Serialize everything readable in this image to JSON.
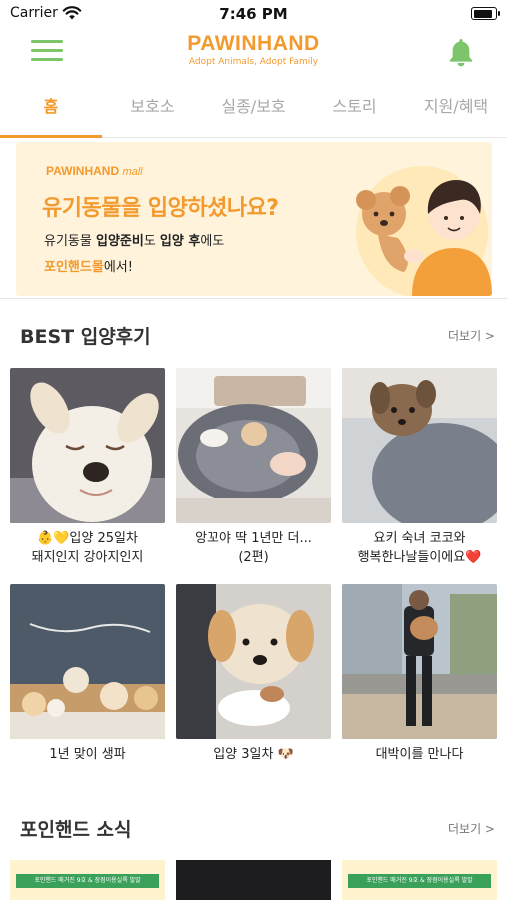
{
  "status_bar": {
    "carrier": "Carrier",
    "time": "7:46 PM"
  },
  "header": {
    "logo": "PAWINHAND",
    "tagline": "Adopt Animals, Adopt Family"
  },
  "tabs": [
    {
      "label": "홈"
    },
    {
      "label": "보호소"
    },
    {
      "label": "실종/보호"
    },
    {
      "label": "스토리"
    },
    {
      "label": "지원/혜택"
    }
  ],
  "banner": {
    "brand": "PAWINHAND",
    "brand_suffix": "mall",
    "headline": "유기동물을 입양하셨나요?",
    "line1_a": "유기동물 ",
    "line1_b": "입양준비",
    "line1_c": "도 ",
    "line1_d": "입양 후",
    "line1_e": "에도",
    "line2_a": "포인핸드몰",
    "line2_b": "에서!"
  },
  "reviews": {
    "title": "BEST 입양후기",
    "more": "더보기 >",
    "items": [
      {
        "caption_l1": "👶💛입양 25일차",
        "caption_l2": "돼지인지 강아지인지"
      },
      {
        "caption_l1": "앙꼬야 딱 1년만 더...",
        "caption_l2": "(2편)"
      },
      {
        "caption_l1": "요키 숙녀 코코와",
        "caption_l2": "행복한나날들이에요❤️"
      },
      {
        "caption_l1": "1년 맞이 생파",
        "caption_l2": ""
      },
      {
        "caption_l1": "입양 3일차 🐶",
        "caption_l2": ""
      },
      {
        "caption_l1": "대박이를 만나다",
        "caption_l2": ""
      }
    ]
  },
  "news": {
    "title": "포인핸드 소식",
    "more": "더보기 >",
    "items": [
      {
        "badge": "포인핸드 매거진 9호 & 장점이용실록 발발"
      },
      {
        "badge": ""
      },
      {
        "badge": "포인핸드 매거진 9호 & 장점이용실록 발발"
      }
    ]
  },
  "colors": {
    "brand": "#f39a2e",
    "menu": "#7cc56a",
    "banner_bg": "#fff3dc"
  },
  "icons": {
    "menu": "hamburger-icon",
    "notifications": "bell-icon",
    "wifi": "wifi-icon",
    "battery": "battery-icon"
  },
  "battery_level": 0.9
}
